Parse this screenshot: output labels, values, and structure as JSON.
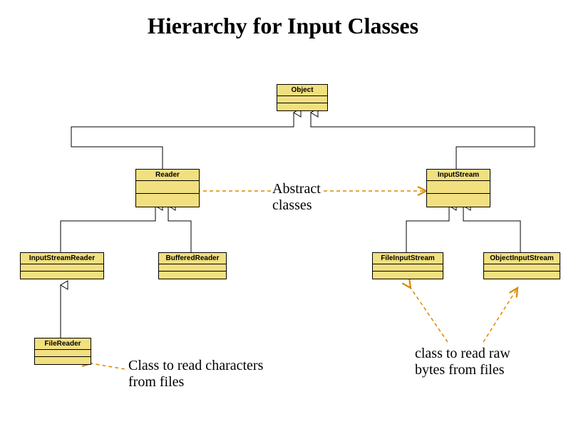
{
  "title": "Hierarchy for Input Classes",
  "classes": {
    "object": "Object",
    "reader": "Reader",
    "inputStream": "InputStream",
    "inputStreamReader": "InputStreamReader",
    "bufferedReader": "BufferedReader",
    "fileInputStream": "FileInputStream",
    "objectInputStream": "ObjectInputStream",
    "fileReader": "FileReader"
  },
  "annotations": {
    "abstract": "Abstract classes",
    "charsFromFiles": "Class to read characters from files",
    "bytesFromFiles": "class to read raw bytes from files"
  }
}
